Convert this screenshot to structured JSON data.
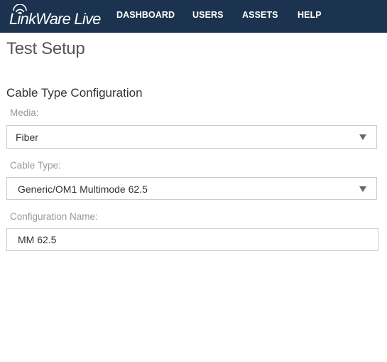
{
  "header": {
    "logo_text": "LinkWare Live",
    "nav": [
      "DASHBOARD",
      "USERS",
      "ASSETS",
      "HELP"
    ],
    "background_color": "#1c3350"
  },
  "page": {
    "title": "Test Setup",
    "section_title": "Cable Type Configuration"
  },
  "form": {
    "media": {
      "label": "Media:",
      "value": "Fiber"
    },
    "cable_type": {
      "label": "Cable Type:",
      "value": "Generic/OM1 Multimode 62.5"
    },
    "config_name": {
      "label": "Configuration Name:",
      "value": "MM 62.5"
    }
  }
}
